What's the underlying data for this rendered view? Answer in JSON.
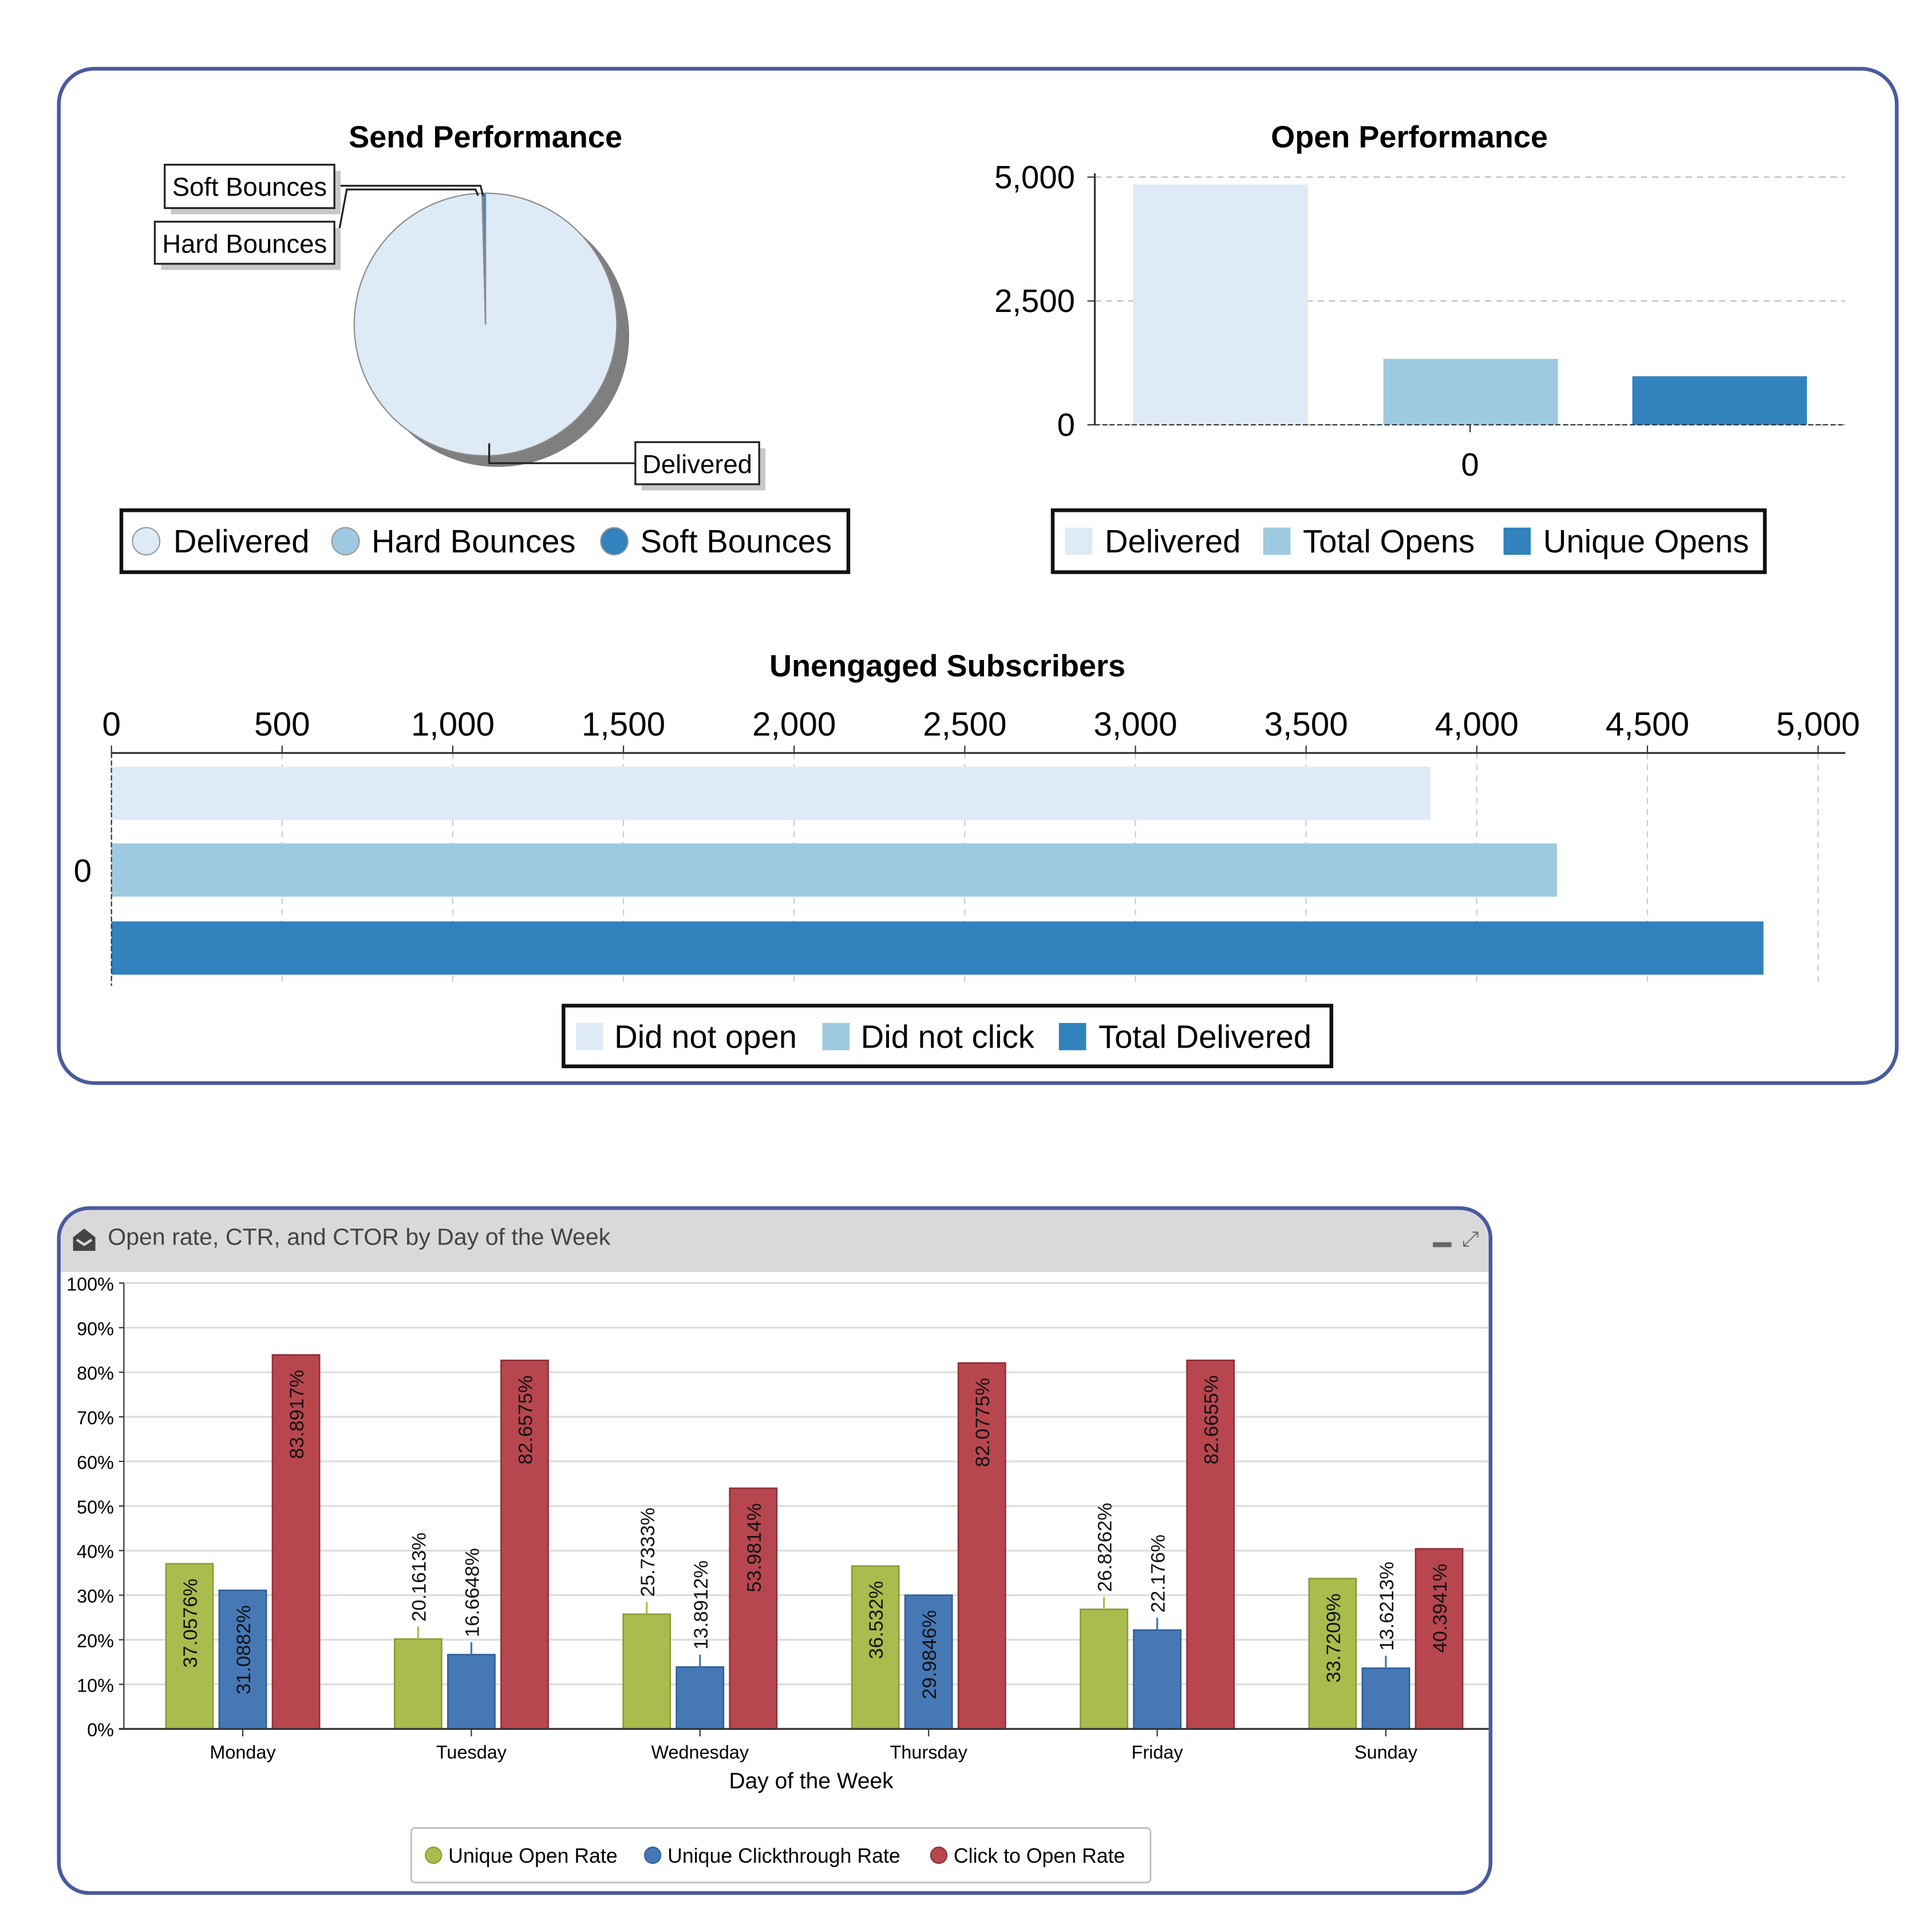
{
  "colors": {
    "light": "#deeaf6",
    "mid": "#9ecae1",
    "dark": "#3182bd",
    "green": "#a9bc4d",
    "blue": "#4678b6",
    "red": "#b8464f",
    "panel_border": "#4a5a9e"
  },
  "bottom_panel": {
    "title": "Open rate, CTR, and CTOR by Day of the Week",
    "icons": [
      "envelope-open-icon",
      "minimize-icon",
      "expand-icon"
    ]
  },
  "chart_data": [
    {
      "type": "pie",
      "title": "Send Performance",
      "labels": [
        "Delivered",
        "Hard Bounces",
        "Soft Bounces"
      ],
      "values": [
        4850,
        5,
        15
      ],
      "callouts": [
        "Soft Bounces",
        "Hard Bounces",
        "Delivered"
      ],
      "legend": [
        "Delivered",
        "Hard Bounces",
        "Soft Bounces"
      ],
      "legend_placement": "bottom"
    },
    {
      "type": "bar",
      "title": "Open Performance",
      "categories": [
        "0"
      ],
      "series": [
        {
          "name": "Delivered",
          "values": [
            4850
          ]
        },
        {
          "name": "Total Opens",
          "values": [
            1330
          ]
        },
        {
          "name": "Unique Opens",
          "values": [
            980
          ]
        }
      ],
      "ylim": [
        0,
        5000
      ],
      "yticks": [
        "0",
        "2,500",
        "5,000"
      ],
      "ytick_values": [
        0,
        2500,
        5000
      ],
      "grid": true,
      "legend_placement": "bottom"
    },
    {
      "type": "bar",
      "orientation": "horizontal",
      "title": "Unengaged Subscribers",
      "categories": [
        "0"
      ],
      "series": [
        {
          "name": "Did not open",
          "values": [
            3865
          ]
        },
        {
          "name": "Did not click",
          "values": [
            4235
          ]
        },
        {
          "name": "Total Delivered",
          "values": [
            4840
          ]
        }
      ],
      "xlim": [
        0,
        5000
      ],
      "xticks": [
        "0",
        "500",
        "1,000",
        "1,500",
        "2,000",
        "2,500",
        "3,000",
        "3,500",
        "4,000",
        "4,500",
        "5,000"
      ],
      "grid": true,
      "legend_placement": "bottom"
    },
    {
      "type": "bar",
      "xlabel": "Day of the Week",
      "categories": [
        "Monday",
        "Tuesday",
        "Wednesday",
        "Thursday",
        "Friday",
        "Sunday"
      ],
      "series": [
        {
          "name": "Unique Open Rate",
          "values": [
            37.0576,
            20.1613,
            25.7333,
            36.532,
            26.8262,
            33.7209
          ],
          "labels": [
            "37.0576%",
            "20.1613%",
            "25.7333%",
            "36.532%",
            "26.8262%",
            "33.7209%"
          ]
        },
        {
          "name": "Unique Clickthrough Rate",
          "values": [
            31.0882,
            16.6648,
            13.8912,
            29.9846,
            22.176,
            13.6213
          ],
          "labels": [
            "31.0882%",
            "16.6648%",
            "13.8912%",
            "29.9846%",
            "22.176%",
            "13.6213%"
          ]
        },
        {
          "name": "Click to Open Rate",
          "values": [
            83.8917,
            82.6575,
            53.9814,
            82.0775,
            82.6655,
            40.3941
          ],
          "labels": [
            "83.8917%",
            "82.6575%",
            "53.9814%",
            "82.0775%",
            "82.6655%",
            "40.3941%"
          ]
        }
      ],
      "ylim": [
        0,
        100
      ],
      "yticks": [
        "0%",
        "10%",
        "20%",
        "30%",
        "40%",
        "50%",
        "60%",
        "70%",
        "80%",
        "90%",
        "100%"
      ],
      "grid": true,
      "legend_placement": "bottom"
    }
  ]
}
